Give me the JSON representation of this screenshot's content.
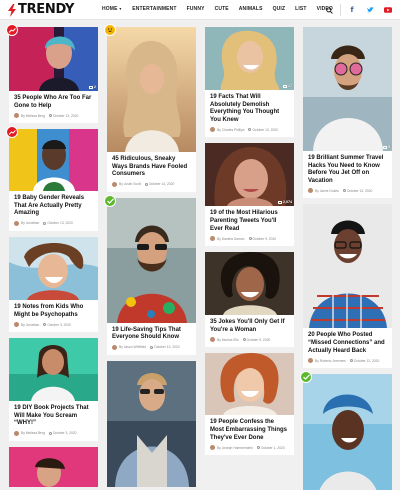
{
  "brand": {
    "name": "TRENDY",
    "accent": "#e21b22"
  },
  "nav": [
    {
      "label": "HOME",
      "has_caret": true
    },
    {
      "label": "ENTERTAINMENT",
      "has_caret": false
    },
    {
      "label": "FUNNY",
      "has_caret": false
    },
    {
      "label": "CUTE",
      "has_caret": false
    },
    {
      "label": "ANIMALS",
      "has_caret": false
    },
    {
      "label": "QUIZ",
      "has_caret": false
    },
    {
      "label": "LIST",
      "has_caret": false
    },
    {
      "label": "VIDEO",
      "has_caret": false
    }
  ],
  "header_icons": [
    "search-icon",
    "facebook-icon",
    "twitter-icon",
    "youtube-icon"
  ],
  "badge_colors": {
    "trending": "#e21b22",
    "emoji": "#f5b400",
    "hot": "#5cb82d"
  },
  "columns": [
    {
      "cards": [
        {
          "title": "35 People Who Are Too Far Gone to Help",
          "author": "By Melissa Berg",
          "date": "October 13, 2020",
          "count": "2",
          "badge": "trending",
          "badge_icon": "trending-up-icon"
        },
        {
          "title": "19 Baby Gender Reveals That Are Actually Pretty Amazing",
          "author": "By Jonathan",
          "date": "October 13, 2020",
          "count": "",
          "badge": "trending",
          "badge_icon": "trending-up-icon"
        },
        {
          "title": "19 Notes from Kids Who Might be Psychopaths",
          "author": "By Jonathan",
          "date": "October 3, 2020",
          "count": "",
          "badge": "",
          "badge_icon": ""
        },
        {
          "title": "19 DIY Book Projects That Will Make You Scream “WHY!”",
          "author": "By Melissa Berg",
          "date": "October 3, 2020",
          "count": "",
          "badge": "",
          "badge_icon": ""
        },
        {
          "title": "",
          "author": "",
          "date": "",
          "count": "",
          "badge": "",
          "badge_icon": ""
        }
      ]
    },
    {
      "cards": [
        {
          "title": "45 Ridiculous, Sneaky Ways Brands Have Fooled Consumers",
          "author": "By Justin Scott",
          "date": "October 14, 2020",
          "count": "",
          "badge": "emoji",
          "badge_icon": "grin-icon"
        },
        {
          "title": "19 Life-Saving Tips That Everyone Should Know",
          "author": "By Jason Whitfield",
          "date": "October 12, 2020",
          "count": "",
          "badge": "hot",
          "badge_icon": "check-icon"
        },
        {
          "title": "",
          "author": "",
          "date": "",
          "count": "",
          "badge": "",
          "badge_icon": ""
        }
      ]
    },
    {
      "cards": [
        {
          "title": "19 Facts That Will Absolutely Demolish Everything You Thought You Knew",
          "author": "By Charles Phillips",
          "date": "October 13, 2020",
          "count": "17",
          "badge": "",
          "badge_icon": ""
        },
        {
          "title": "19 of the Most Hilarious Parenting Tweets You'll Ever Read",
          "author": "By Daniela Damon",
          "date": "October 9, 2020",
          "count": "2,074",
          "badge": "",
          "badge_icon": ""
        },
        {
          "title": "35 Jokes You'll Only Get If You're a Woman",
          "author": "By Monica Ells",
          "date": "October 5, 2020",
          "count": "",
          "badge": "",
          "badge_icon": ""
        },
        {
          "title": "19 People Confess the Most Embarrassing Things They've Ever Done",
          "author": "By Joseph Hammerstein",
          "date": "October 1, 2020",
          "count": "",
          "badge": "",
          "badge_icon": ""
        }
      ]
    },
    {
      "cards": [
        {
          "title": "19 Brilliant Summer Travel Hacks You Need to Know Before You Jet Off on Vacation",
          "author": "By Jamie Dukes",
          "date": "October 13, 2020",
          "count": "5",
          "badge": "",
          "badge_icon": ""
        },
        {
          "title": "20 People Who Posted “Missed Connections” and Actually Heard Back",
          "author": "By Roberto Jeremies",
          "date": "October 12, 2020",
          "count": "",
          "badge": "",
          "badge_icon": ""
        },
        {
          "title": "",
          "author": "",
          "date": "",
          "count": "",
          "badge": "hot",
          "badge_icon": "check-icon"
        }
      ]
    }
  ]
}
